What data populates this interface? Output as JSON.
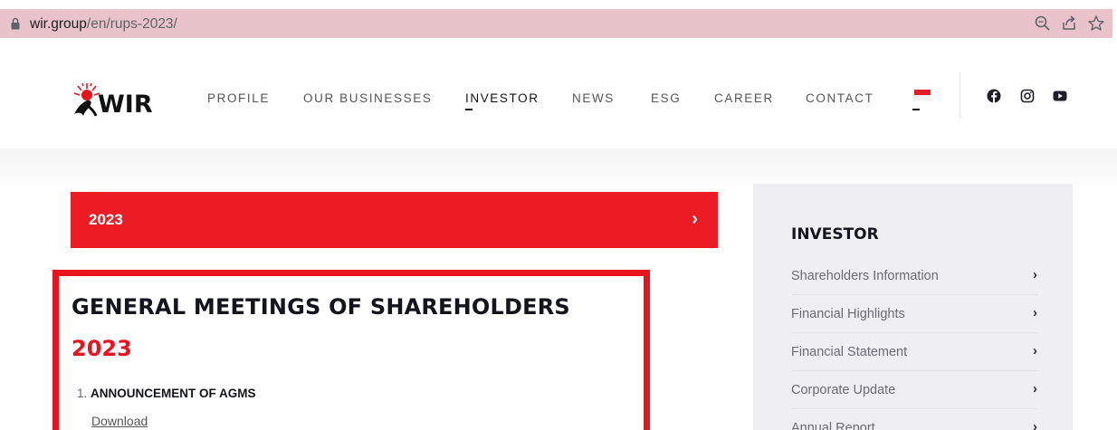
{
  "browser": {
    "url_host": "wir.group",
    "url_path": "/en/rups-2023/"
  },
  "header": {
    "logo_text": "WIR",
    "nav": [
      "PROFILE",
      "OUR BUSINESSES",
      "INVESTOR",
      "NEWS",
      "ESG",
      "CAREER",
      "CONTACT"
    ],
    "active_nav": "INVESTOR"
  },
  "year_bar": {
    "label": "2023",
    "chevron": "›"
  },
  "main": {
    "title": "GENERAL MEETINGS OF SHAREHOLDERS",
    "year": "2023",
    "items": [
      {
        "number": "1.",
        "title": "ANNOUNCEMENT OF AGMS",
        "link": "Download"
      }
    ]
  },
  "sidebar": {
    "title": "INVESTOR",
    "items": [
      "Shareholders Information",
      "Financial Highlights",
      "Financial Statement",
      "Corporate Update",
      "Annual Report"
    ],
    "chevron": "›"
  },
  "colors": {
    "brand_red": "#ec1c24",
    "address_bar": "#e8c3c9",
    "sidebar_bg": "#efeff3"
  },
  "icons": [
    "lock-icon",
    "zoom-icon",
    "share-icon",
    "bookmark-star-icon",
    "indonesia-flag-icon",
    "facebook-icon",
    "instagram-icon",
    "youtube-icon"
  ]
}
